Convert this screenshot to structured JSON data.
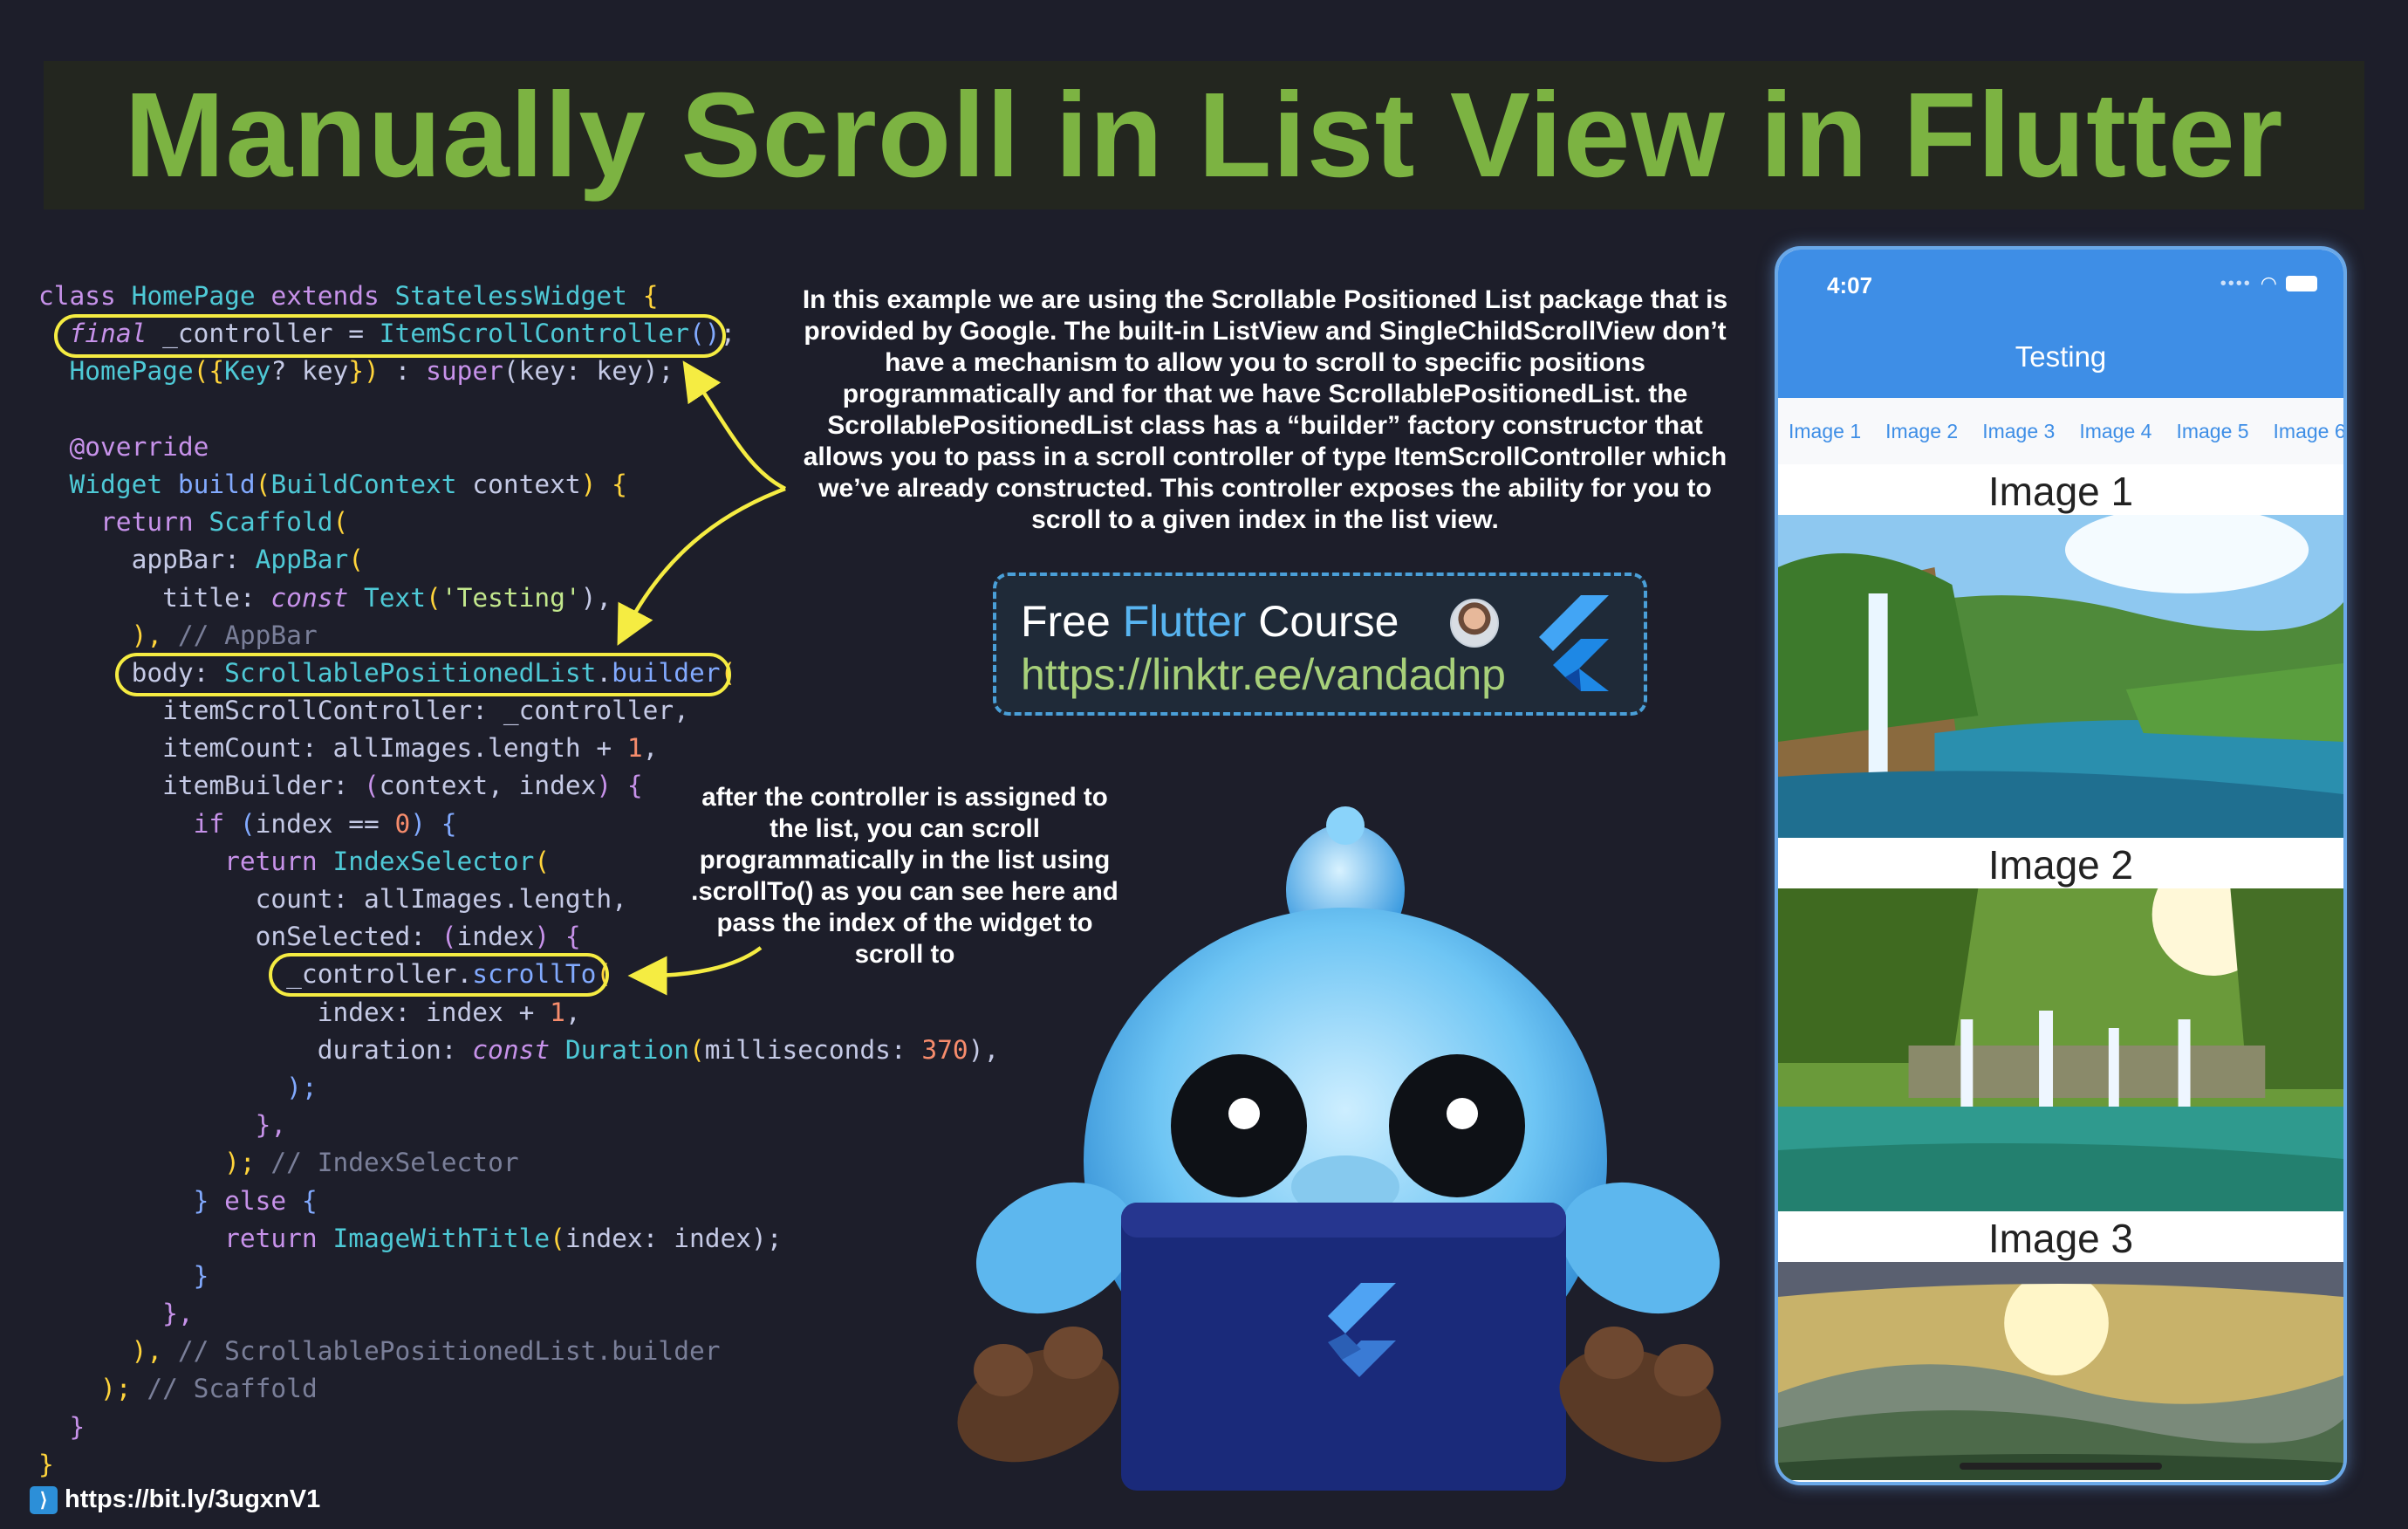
{
  "title": "Manually Scroll in List View in Flutter",
  "code_lines": [
    [
      [
        "class ",
        "k"
      ],
      [
        "HomePage ",
        "t"
      ],
      [
        "extends ",
        "k"
      ],
      [
        "StatelessWidget ",
        "t"
      ],
      [
        "{",
        "p"
      ]
    ],
    [
      [
        "  ",
        " "
      ],
      [
        "final",
        "i"
      ],
      [
        " _controller = ",
        "a"
      ],
      [
        "ItemScrollController",
        "t"
      ],
      [
        "()",
        "f"
      ],
      [
        ";",
        "a"
      ]
    ],
    [
      [
        "  ",
        " "
      ],
      [
        "HomePage",
        "t"
      ],
      [
        "({",
        "p"
      ],
      [
        "Key",
        "t"
      ],
      [
        "? key",
        "a"
      ],
      [
        "}) ",
        "p"
      ],
      [
        ": ",
        "a"
      ],
      [
        "super",
        "k"
      ],
      [
        "(key: key);",
        "a"
      ]
    ],
    [
      [
        "",
        ""
      ]
    ],
    [
      [
        "  @override",
        "k"
      ]
    ],
    [
      [
        "  ",
        " "
      ],
      [
        "Widget ",
        "t"
      ],
      [
        "build",
        "f"
      ],
      [
        "(",
        "p"
      ],
      [
        "BuildContext ",
        "t"
      ],
      [
        "context",
        "a"
      ],
      [
        ") {",
        "p"
      ]
    ],
    [
      [
        "    return ",
        "k"
      ],
      [
        "Scaffold",
        "t"
      ],
      [
        "(",
        "p"
      ]
    ],
    [
      [
        "      appBar: ",
        "a"
      ],
      [
        "AppBar",
        "t"
      ],
      [
        "(",
        "p"
      ]
    ],
    [
      [
        "        title: ",
        "a"
      ],
      [
        "const ",
        "i"
      ],
      [
        "Text",
        "t"
      ],
      [
        "(",
        "p"
      ],
      [
        "'Testing'",
        "s"
      ],
      [
        "),",
        "a"
      ]
    ],
    [
      [
        "      ),",
        "p"
      ],
      [
        " // AppBar",
        "c"
      ]
    ],
    [
      [
        "      body: ",
        "a"
      ],
      [
        "ScrollablePositionedList",
        "t"
      ],
      [
        ".",
        "a"
      ],
      [
        "builder",
        "f"
      ],
      [
        "(",
        "p"
      ]
    ],
    [
      [
        "        itemScrollController: _controller,",
        "a"
      ]
    ],
    [
      [
        "        itemCount: allImages.length + ",
        "a"
      ],
      [
        "1",
        "n"
      ],
      [
        ",",
        "a"
      ]
    ],
    [
      [
        "        itemBuilder: ",
        "a"
      ],
      [
        "(",
        "k"
      ],
      [
        "context, index",
        "a"
      ],
      [
        ") {",
        "k"
      ]
    ],
    [
      [
        "          if ",
        "k"
      ],
      [
        "(",
        "f"
      ],
      [
        "index == ",
        "a"
      ],
      [
        "0",
        "n"
      ],
      [
        ") {",
        "f"
      ]
    ],
    [
      [
        "            return ",
        "k"
      ],
      [
        "IndexSelector",
        "t"
      ],
      [
        "(",
        "p"
      ]
    ],
    [
      [
        "              count: allImages.length,",
        "a"
      ]
    ],
    [
      [
        "              onSelected: ",
        "a"
      ],
      [
        "(",
        "k"
      ],
      [
        "index",
        "a"
      ],
      [
        ") {",
        "k"
      ]
    ],
    [
      [
        "                _controller.",
        "a"
      ],
      [
        "scrollTo",
        "f"
      ],
      [
        "(",
        "p"
      ]
    ],
    [
      [
        "                  index: index + ",
        "a"
      ],
      [
        "1",
        "n"
      ],
      [
        ",",
        "a"
      ]
    ],
    [
      [
        "                  duration: ",
        "a"
      ],
      [
        "const ",
        "i"
      ],
      [
        "Duration",
        "t"
      ],
      [
        "(",
        "p"
      ],
      [
        "milliseconds: ",
        "a"
      ],
      [
        "370",
        "n"
      ],
      [
        "),",
        "a"
      ]
    ],
    [
      [
        "                );",
        "f"
      ]
    ],
    [
      [
        "              },",
        "k"
      ]
    ],
    [
      [
        "            );",
        "p"
      ],
      [
        " // IndexSelector",
        "c"
      ]
    ],
    [
      [
        "          } ",
        "f"
      ],
      [
        "else ",
        "k"
      ],
      [
        "{",
        "f"
      ]
    ],
    [
      [
        "            return ",
        "k"
      ],
      [
        "ImageWithTitle",
        "t"
      ],
      [
        "(",
        "p"
      ],
      [
        "index: index",
        "a"
      ],
      [
        ");",
        "a"
      ]
    ],
    [
      [
        "          }",
        "f"
      ]
    ],
    [
      [
        "        },",
        "k"
      ]
    ],
    [
      [
        "      ),",
        "p"
      ],
      [
        " // ScrollablePositionedList.builder",
        "c"
      ]
    ],
    [
      [
        "    );",
        "p"
      ],
      [
        " // Scaffold",
        "c"
      ]
    ],
    [
      [
        "  }",
        "k"
      ]
    ],
    [
      [
        "}",
        "p"
      ]
    ]
  ],
  "explanation": "In this example we are using the Scrollable Positioned List package that is provided by Google. The built-in ListView and SingleChildScrollView don’t have a mechanism to allow you to scroll to specific positions programmatically and for that we have ScrollablePositionedList. the ScrollablePositionedList class has a “builder” factory constructor that allows you to pass in a scroll controller of type ItemScrollController which we’ve already constructed. This controller exposes the ability for you to scroll to a given index in the list view.",
  "explanation2": "after the controller is assigned to the list, you can scroll programmatically in the list using .scrollTo() as you can see here and pass the index of the widget to scroll to",
  "course": {
    "free": "Free ",
    "flutter": "Flutter",
    "course": " Course",
    "link": "https://linktr.ee/vandadnp"
  },
  "bottom_link": "https://bit.ly/3ugxnV1",
  "phone": {
    "time": "4:07",
    "app_title": "Testing",
    "tabs": [
      "Image 1",
      "Image 2",
      "Image 3",
      "Image 4",
      "Image 5",
      "Image 6"
    ],
    "items": [
      {
        "title": "Image 1",
        "scene": "waterfall-lake"
      },
      {
        "title": "Image 2",
        "scene": "forest-waterfalls"
      },
      {
        "title": "Image 3",
        "scene": "mountain-sunrise"
      }
    ]
  },
  "colors": {
    "title": "#7cb342",
    "highlight": "#f5ec42",
    "appbar": "#3e8ee6",
    "background": "#1d1e2a"
  }
}
